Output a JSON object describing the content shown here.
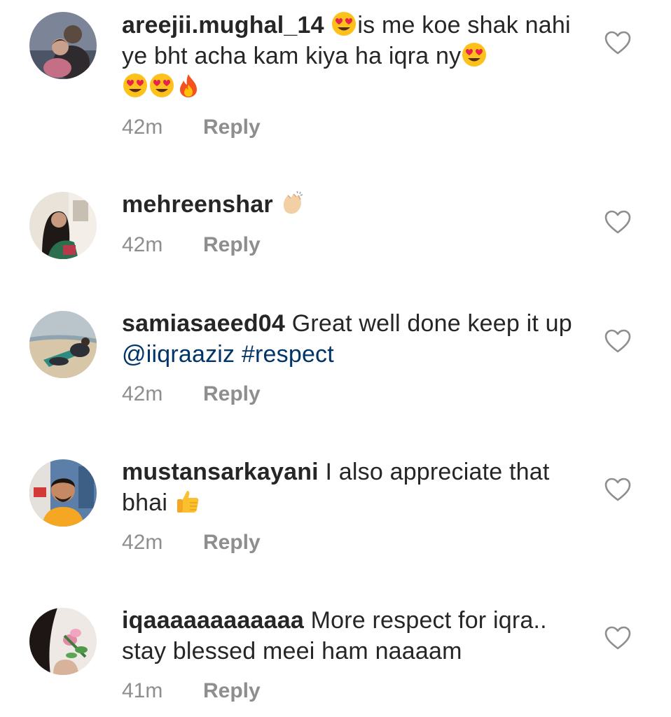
{
  "comments": [
    {
      "username": "areejii.mughal_14",
      "text_part1": "is me koe shak nahi ye bht acha kam kiya  ha iqra ny",
      "emojis_before": [
        "heart-eyes-emoji"
      ],
      "emojis_after": [
        "heart-eyes-emoji",
        "heart-eyes-emoji",
        "heart-eyes-emoji",
        "fire-emoji"
      ],
      "time": "42m",
      "reply_label": "Reply"
    },
    {
      "username": "mehreenshar",
      "emojis_after": [
        "clapping-hands-emoji"
      ],
      "time": "42m",
      "reply_label": "Reply"
    },
    {
      "username": "samiasaeed04",
      "text_part1": "Great well done keep it up",
      "mention": "@iiqraaziz",
      "hashtag": "#respect",
      "time": "42m",
      "reply_label": "Reply"
    },
    {
      "username": "mustansarkayani",
      "text_part1": "I also appreciate that bhai",
      "emojis_after": [
        "thumbs-up-emoji"
      ],
      "time": "42m",
      "reply_label": "Reply"
    },
    {
      "username": "iqaaaaaaaaaaaa",
      "text_part1": "More respect for iqra.. stay blessed meei ham naaaam",
      "time": "41m",
      "reply_label": "Reply"
    }
  ],
  "colors": {
    "text": "#262626",
    "meta": "#8e8e8e",
    "link": "#003569",
    "background": "#ffffff"
  }
}
